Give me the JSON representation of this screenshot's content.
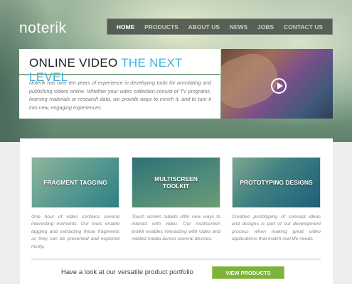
{
  "header": {
    "logo": "noterik",
    "nav": [
      "HOME",
      "PRODUCTS",
      "ABOUT US",
      "NEWS",
      "JOBS",
      "CONTACT US"
    ]
  },
  "intro": {
    "title_main": "ONLINE VIDEO",
    "title_accent": "THE NEXT LEVEL",
    "text": "Noterik has over ten years of experience in developing tools for annotating and publishing videos online. Whether your video collection consist of TV programs, learning materials or research data, we provide ways to enrich it, and to turn it into new, engaging experiences."
  },
  "features": [
    {
      "title": "FRAGMENT TAGGING",
      "text": "One hour of video contains several interesting moments. Our tools enable tagging and extracting these fragments so they can be presented and explored nicely."
    },
    {
      "title": "MULTISCREEN TOOLKIT",
      "text": "Touch screen tablets offer new ways to interact with video. Our multiscreen toolkit enables interacting with video and related media across several devices."
    },
    {
      "title": "PROTOTYPING DESIGNS",
      "text": "Creative prototyping of concept ideas and designs is part of our development process when making great video applications that match real life needs."
    }
  ],
  "cta": {
    "text": "Have a look at our versatile product portfolio",
    "button": "VIEW PRODUCTS"
  },
  "colors": {
    "accent": "#3fb2de",
    "button": "#7db33a"
  }
}
